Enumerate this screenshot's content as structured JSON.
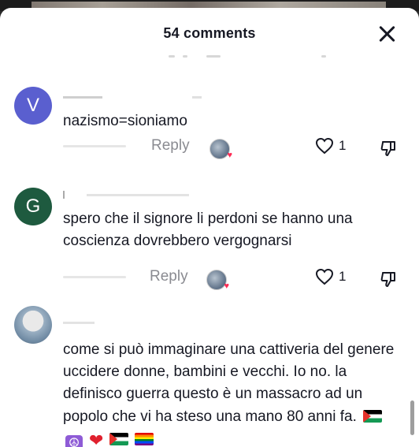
{
  "header": {
    "title": "54 comments"
  },
  "comments": [
    {
      "avatar_letter": "V",
      "avatar_color": "#5a5fcf",
      "text": "nazismo=sioniamo",
      "reply_label": "Reply",
      "like_count": "1"
    },
    {
      "avatar_letter": "G",
      "avatar_color": "#1e5a3f",
      "text": "spero che il signore li perdoni se hanno una coscienza dovrebbero vergognarsi",
      "reply_label": "Reply",
      "like_count": "1"
    },
    {
      "avatar_letter": "",
      "text": "come si può immaginare una cattiveria del genere uccidere donne, bambini e vecchi. Io no. la definisco guerra questo è un massacro ad un popolo che vi ha steso una mano 80 anni fa."
    }
  ],
  "icons": {
    "close": "close-icon",
    "like": "heart-outline-icon",
    "dislike": "thumbs-down-icon",
    "reaction": "creator-reaction-icon"
  },
  "colors": {
    "text": "#161823",
    "muted": "#8a8b91",
    "like_red": "#fe2c55"
  }
}
